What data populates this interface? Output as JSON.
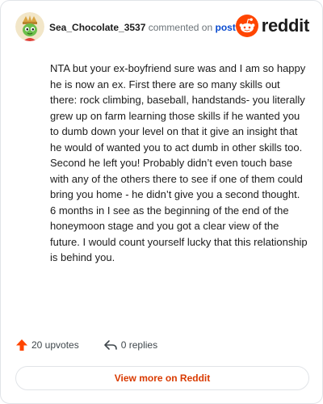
{
  "comment": {
    "username": "Sea_Chocolate_3537",
    "action_text": "commented on",
    "post_link_text": "post",
    "body": "NTA but your ex-boyfriend sure was and I am so happy he is now an ex. First there are so many skills out there: rock climbing, baseball, handstands- you literally grew up on farm learning those skills if he wanted you to dumb down your level on that it give an insight that he would of wanted you to act dumb in other skills too. Second he left you! Probably didn’t even touch base with any of the others there to see if one of them could bring you home - he didn’t give you a second thought. 6 months in I see as the beginning of the end of the honeymoon stage and you got a clear view of the future. I would count yourself lucky that this relationship is behind you.",
    "upvotes_text": "20 upvotes",
    "replies_text": "0 replies"
  },
  "brand": {
    "wordmark": "reddit",
    "color": "#ff4500"
  },
  "footer": {
    "view_more_label": "View more on Reddit"
  },
  "icons": {
    "avatar": "snoo-avatar",
    "logo": "reddit-logo-icon",
    "upvote": "upvote-arrow-icon",
    "reply": "reply-arrow-icon"
  },
  "colors": {
    "upvote": "#ff4500",
    "link": "#0a4bcf",
    "cta_text": "#d93a00"
  }
}
